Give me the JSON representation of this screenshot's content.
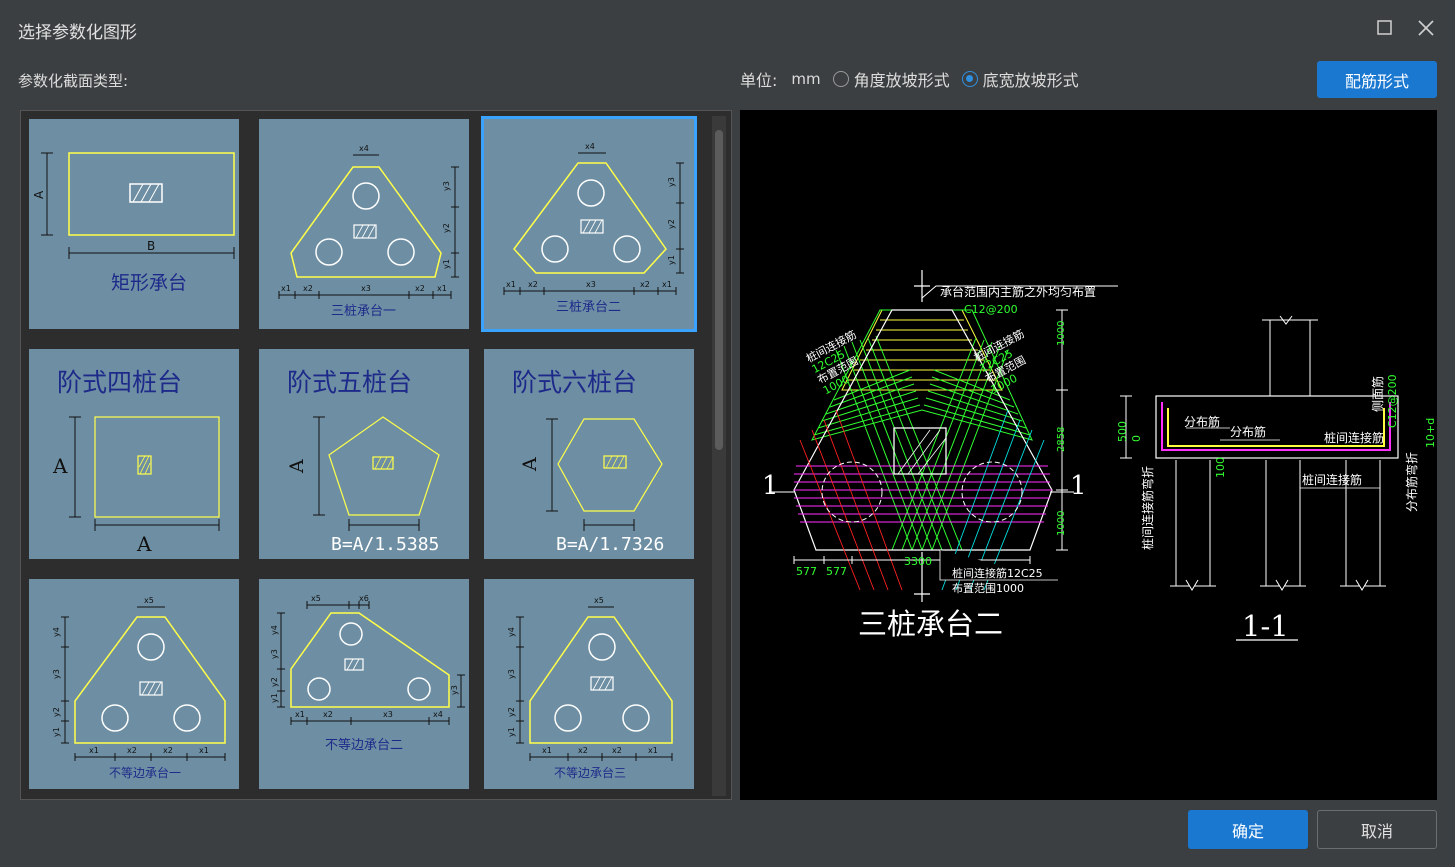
{
  "window": {
    "title": "选择参数化图形"
  },
  "section_label": "参数化截面类型:",
  "unit": {
    "label": "单位:",
    "value": "mm",
    "options": [
      {
        "label": "角度放坡形式",
        "selected": false
      },
      {
        "label": "底宽放坡形式",
        "selected": true
      }
    ]
  },
  "buttons": {
    "rebar_form": "配筋形式",
    "ok": "确定",
    "cancel": "取消"
  },
  "tiles": {
    "t1": {
      "name": "矩形承台",
      "dim_a": "A",
      "dim_b": "B"
    },
    "t2": {
      "name": "三桩承台一",
      "x1": "x1",
      "x2": "x2",
      "x3": "x3",
      "x4": "x4",
      "y1": "y1",
      "y2": "y2",
      "y3": "y3"
    },
    "t3": {
      "name": "三桩承台二",
      "x1": "x1",
      "x2": "x2",
      "x3": "x3",
      "x4": "x4",
      "y1": "y1",
      "y2": "y2",
      "y3": "y3"
    },
    "t4": {
      "name": "阶式四桩台",
      "dim": "A"
    },
    "t5": {
      "name": "阶式五桩台",
      "dim": "A",
      "formula": "B=A/1.5385"
    },
    "t6": {
      "name": "阶式六桩台",
      "dim": "A",
      "formula": "B=A/1.7326"
    },
    "t7": {
      "name": "不等边承台一",
      "x1": "x1",
      "x2": "x2",
      "x5": "x5",
      "y1": "y1",
      "y2": "y2",
      "y3": "y3",
      "y4": "y4"
    },
    "t8": {
      "name": "不等边承台二",
      "x1": "x1",
      "x2": "x2",
      "x3": "x3",
      "x4": "x4",
      "x5": "x5",
      "x6": "x6",
      "y1": "y1",
      "y2": "y2",
      "y3": "y3",
      "y4": "y4"
    },
    "t9": {
      "name": "不等边承台三",
      "x1": "x1",
      "x2": "x2",
      "x5": "x5",
      "y1": "y1",
      "y2": "y2",
      "y3": "y3",
      "y4": "y4"
    }
  },
  "preview": {
    "title": "三桩承台二",
    "section_title": "1-1",
    "section_mark": "1",
    "ann_top": "承台范围内主筋之外均匀布置",
    "ann_top_rebar": "C12@200",
    "ann_left1": "桩间连接筋",
    "ann_left2": "12C25",
    "ann_left3": "布置范围",
    "ann_left4": "1000",
    "ann_right1": "桩间连接筋",
    "ann_right2": "12C25",
    "ann_right3": "布置范围",
    "ann_right4": "1000",
    "dim_v1": "1000",
    "dim_v2": "2858",
    "dim_v3": "1000",
    "dim_b1": "577",
    "dim_b2": "577",
    "dim_b3": "3300",
    "ann_bottom1": "桩间连接筋12C25",
    "ann_bottom2": "布置范围1000",
    "sec_dist1": "分布筋",
    "sec_dist2": "分布筋",
    "sec_link": "桩间连接筋",
    "sec_link2": "桩间连接筋",
    "sec_side": "侧面筋",
    "sec_side_rebar": "C12@200",
    "sec_h": "500",
    "sec_zero": "0",
    "sec_100": "100",
    "sec_10d": "10+d",
    "sec_left_v": "桩间连接筋弯折",
    "sec_right_v": "分布筋弯折"
  }
}
